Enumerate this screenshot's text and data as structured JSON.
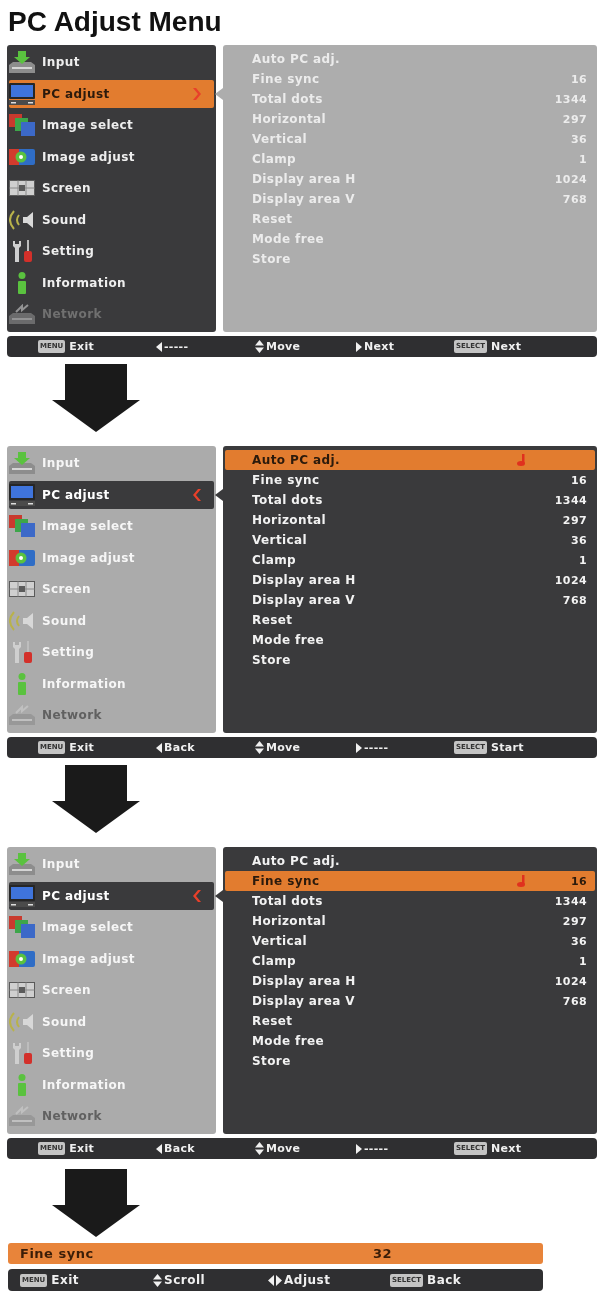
{
  "title": "PC Adjust Menu",
  "screens": [
    {
      "submenu_focused": false,
      "main_menu": [
        {
          "label": "Input",
          "selected": false,
          "disabled": false
        },
        {
          "label": "PC adjust",
          "selected": true,
          "disabled": false
        },
        {
          "label": "Image select",
          "selected": false,
          "disabled": false
        },
        {
          "label": "Image adjust",
          "selected": false,
          "disabled": false
        },
        {
          "label": "Screen",
          "selected": false,
          "disabled": false
        },
        {
          "label": "Sound",
          "selected": false,
          "disabled": false
        },
        {
          "label": "Setting",
          "selected": false,
          "disabled": false
        },
        {
          "label": "Information",
          "selected": false,
          "disabled": false
        },
        {
          "label": "Network",
          "selected": false,
          "disabled": true
        }
      ],
      "submenu": [
        {
          "label": "Auto PC adj.",
          "selected": false
        },
        {
          "label": "Fine sync",
          "value": "16",
          "selected": false
        },
        {
          "label": "Total dots",
          "value": "1344",
          "selected": false
        },
        {
          "label": "Horizontal",
          "value": "297",
          "selected": false
        },
        {
          "label": "Vertical",
          "value": "36",
          "selected": false
        },
        {
          "label": "Clamp",
          "value": "1",
          "selected": false
        },
        {
          "label": "Display area H",
          "value": "1024",
          "selected": false
        },
        {
          "label": "Display area V",
          "value": "768",
          "selected": false
        },
        {
          "label": "Reset",
          "selected": false
        },
        {
          "label": "Mode free",
          "selected": false
        },
        {
          "label": "Store",
          "selected": false
        }
      ],
      "status_bar": [
        {
          "kind": "key",
          "key": "MENU",
          "label": "Exit"
        },
        {
          "kind": "left",
          "label": "-----"
        },
        {
          "kind": "updown",
          "label": "Move"
        },
        {
          "kind": "right",
          "label": "Next"
        },
        {
          "kind": "key",
          "key": "SELECT",
          "label": "Next"
        }
      ]
    },
    {
      "submenu_focused": true,
      "main_menu": [
        {
          "label": "Input",
          "selected": false,
          "disabled": false
        },
        {
          "label": "PC adjust",
          "selected": true,
          "disabled": false
        },
        {
          "label": "Image select",
          "selected": false,
          "disabled": false
        },
        {
          "label": "Image adjust",
          "selected": false,
          "disabled": false
        },
        {
          "label": "Screen",
          "selected": false,
          "disabled": false
        },
        {
          "label": "Sound",
          "selected": false,
          "disabled": false
        },
        {
          "label": "Setting",
          "selected": false,
          "disabled": false
        },
        {
          "label": "Information",
          "selected": false,
          "disabled": false
        },
        {
          "label": "Network",
          "selected": false,
          "disabled": true
        }
      ],
      "submenu": [
        {
          "label": "Auto PC adj.",
          "selected": true
        },
        {
          "label": "Fine sync",
          "value": "16",
          "selected": false
        },
        {
          "label": "Total dots",
          "value": "1344",
          "selected": false
        },
        {
          "label": "Horizontal",
          "value": "297",
          "selected": false
        },
        {
          "label": "Vertical",
          "value": "36",
          "selected": false
        },
        {
          "label": "Clamp",
          "value": "1",
          "selected": false
        },
        {
          "label": "Display area H",
          "value": "1024",
          "selected": false
        },
        {
          "label": "Display area V",
          "value": "768",
          "selected": false
        },
        {
          "label": "Reset",
          "selected": false
        },
        {
          "label": "Mode free",
          "selected": false
        },
        {
          "label": "Store",
          "selected": false
        }
      ],
      "status_bar": [
        {
          "kind": "key",
          "key": "MENU",
          "label": "Exit"
        },
        {
          "kind": "left",
          "label": "Back"
        },
        {
          "kind": "updown",
          "label": "Move"
        },
        {
          "kind": "right",
          "label": "-----"
        },
        {
          "kind": "key",
          "key": "SELECT",
          "label": "Start"
        }
      ]
    },
    {
      "submenu_focused": true,
      "main_menu": [
        {
          "label": "Input",
          "selected": false,
          "disabled": false
        },
        {
          "label": "PC adjust",
          "selected": true,
          "disabled": false
        },
        {
          "label": "Image select",
          "selected": false,
          "disabled": false
        },
        {
          "label": "Image adjust",
          "selected": false,
          "disabled": false
        },
        {
          "label": "Screen",
          "selected": false,
          "disabled": false
        },
        {
          "label": "Sound",
          "selected": false,
          "disabled": false
        },
        {
          "label": "Setting",
          "selected": false,
          "disabled": false
        },
        {
          "label": "Information",
          "selected": false,
          "disabled": false
        },
        {
          "label": "Network",
          "selected": false,
          "disabled": true
        }
      ],
      "submenu": [
        {
          "label": "Auto PC adj.",
          "selected": false
        },
        {
          "label": "Fine sync",
          "value": "16",
          "selected": true
        },
        {
          "label": "Total dots",
          "value": "1344",
          "selected": false
        },
        {
          "label": "Horizontal",
          "value": "297",
          "selected": false
        },
        {
          "label": "Vertical",
          "value": "36",
          "selected": false
        },
        {
          "label": "Clamp",
          "value": "1",
          "selected": false
        },
        {
          "label": "Display area H",
          "value": "1024",
          "selected": false
        },
        {
          "label": "Display area V",
          "value": "768",
          "selected": false
        },
        {
          "label": "Reset",
          "selected": false
        },
        {
          "label": "Mode free",
          "selected": false
        },
        {
          "label": "Store",
          "selected": false
        }
      ],
      "status_bar": [
        {
          "kind": "key",
          "key": "MENU",
          "label": "Exit"
        },
        {
          "kind": "left",
          "label": "Back"
        },
        {
          "kind": "updown",
          "label": "Move"
        },
        {
          "kind": "right",
          "label": "-----"
        },
        {
          "kind": "key",
          "key": "SELECT",
          "label": "Next"
        }
      ]
    }
  ],
  "adjust_bar": {
    "label": "Fine sync",
    "value": "32",
    "status_bar": [
      {
        "kind": "key",
        "key": "MENU",
        "label": "Exit"
      },
      {
        "kind": "updown",
        "label": "Scroll"
      },
      {
        "kind": "leftright",
        "label": "Adjust"
      },
      {
        "kind": "key",
        "key": "SELECT",
        "label": "Back"
      }
    ]
  }
}
